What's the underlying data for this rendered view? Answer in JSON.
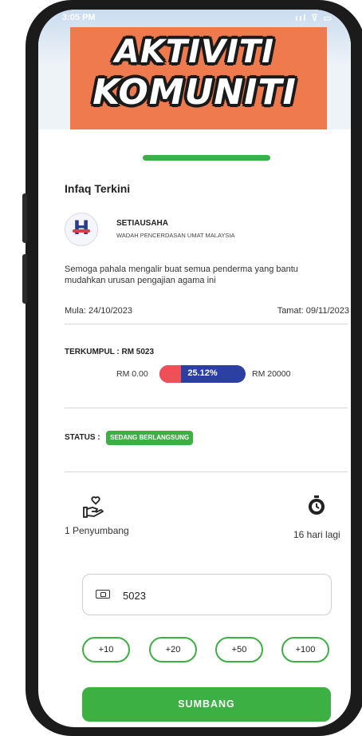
{
  "status_bar": {
    "time": "3:05 PM",
    "icons": "ııl ⊽ ▭"
  },
  "banner": {
    "line1": "AKTIVITI",
    "line2": "KOMUNITI"
  },
  "section_title": "Infaq Terkini",
  "organization": {
    "name": "SETIAUSAHA",
    "subtitle": "WADAH PENCERDASAN UMAT MALAYSIA",
    "logo_letter": "H"
  },
  "description": "Semoga pahala mengalir buat semua penderma yang bantu mudahkan urusan pengajian agama ini",
  "dates": {
    "start": "Mula: 24/10/2023",
    "end": "Tamat: 09/11/2023"
  },
  "collected": "TERKUMPUL : RM 5023",
  "progress": {
    "min_label": "RM 0.00",
    "max_label": "RM 20000",
    "percent_label": "25.12%",
    "fraction": 0.2512
  },
  "status": {
    "label": "STATUS :",
    "badge": "SEDANG BERLANGSUNG"
  },
  "stats": {
    "donors": "1 Penyumbang",
    "days_left": "16 hari lagi"
  },
  "amount_input": {
    "value": "5023"
  },
  "quick_amounts": [
    "+10",
    "+20",
    "+50",
    "+100"
  ],
  "submit_label": "SUMBANG",
  "colors": {
    "accent": "#3cb043",
    "banner": "#ee7a4e",
    "progress_fill": "#ef4f57",
    "progress_track": "#2c3fa3"
  }
}
